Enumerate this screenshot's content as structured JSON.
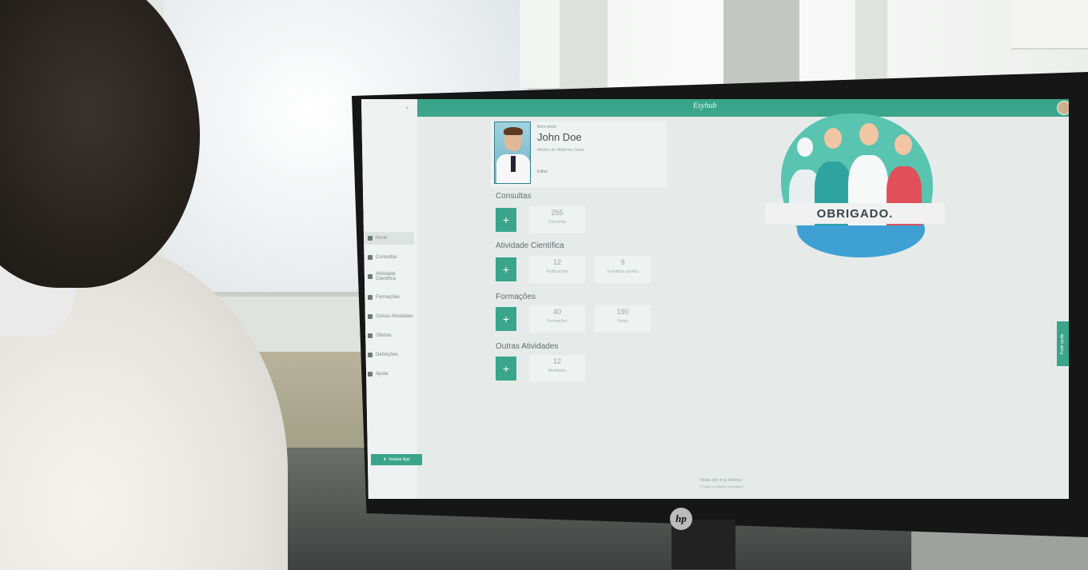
{
  "app": {
    "logo": "Esyhub"
  },
  "sidebar": {
    "items": [
      {
        "label": "Início"
      },
      {
        "label": "Consultas"
      },
      {
        "label": "Atividade Científica"
      },
      {
        "label": "Formações"
      },
      {
        "label": "Outras Atividades"
      },
      {
        "label": "Ofertas"
      },
      {
        "label": "Definições"
      },
      {
        "label": "Ajuda"
      }
    ],
    "install_label": "Instalar App"
  },
  "profile": {
    "welcome": "Bem-vindo",
    "name": "John Doe",
    "specialty": "Médico de Medicina Geral",
    "edit": "Editar"
  },
  "sections": [
    {
      "title": "Consultas",
      "add_label": "+",
      "stats": [
        {
          "value": "255",
          "label": "Consultas"
        }
      ]
    },
    {
      "title": "Atividade Científica",
      "add_label": "+",
      "stats": [
        {
          "value": "12",
          "label": "Publicações"
        },
        {
          "value": "9",
          "label": "Trabalhos aceites"
        }
      ]
    },
    {
      "title": "Formações",
      "add_label": "+",
      "stats": [
        {
          "value": "40",
          "label": "Formações"
        },
        {
          "value": "190",
          "label": "Horas"
        }
      ]
    },
    {
      "title": "Outras Atividades",
      "add_label": "+",
      "stats": [
        {
          "value": "12",
          "label": "Atividades"
        }
      ]
    }
  ],
  "illustration": {
    "banner": "OBRIGADO."
  },
  "help_tab": "Pedir ajuda",
  "footer": {
    "line1": "Made with ♥ by Medsys",
    "line2": "© Todos os direitos reservados"
  },
  "brand": {
    "monitor_logo": "hp"
  },
  "colors": {
    "accent": "#3aa58a",
    "screen_bg": "#e6ebea"
  }
}
